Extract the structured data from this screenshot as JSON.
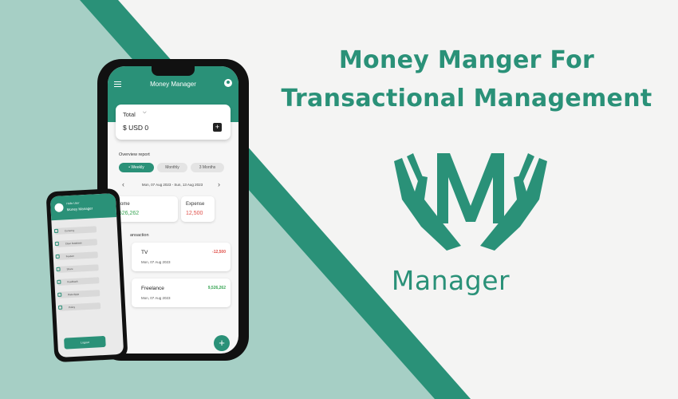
{
  "headline": [
    "Money Manger For",
    "Transactional Management"
  ],
  "logo_word": "Manager",
  "colors": {
    "accent": "#2a9178",
    "accent_light": "#a6cfc5",
    "income": "#3aa655",
    "expense": "#e0504a"
  },
  "app": {
    "title": "Money Manager",
    "total_label": "Total",
    "total_value": "$ USD 0",
    "overview_label": "Overview report",
    "tabs": [
      "Weekly",
      "Monthly",
      "3 Months"
    ],
    "active_tab": "Weekly",
    "date_range": "Mon, 07 Aug 2023 - Sun, 13 Aug 2023",
    "income_label": "Income",
    "income_value": "9,526,262",
    "expense_label": "Expense",
    "expense_value": "12,500",
    "section_label": "ansaction",
    "transactions": [
      {
        "name": "TV",
        "date": "Mon, 07 Aug 2023",
        "amount": "-12,500",
        "type": "expense"
      },
      {
        "name": "Freelance",
        "date": "Mon, 07 Aug 2023",
        "amount": "9,526,262",
        "type": "income"
      }
    ]
  },
  "drawer": {
    "greeting": "Hello User",
    "name": "Money Manager",
    "items": [
      "Currency",
      "Clear Database",
      "Feature",
      "Share",
      "Feedback",
      "Rate Apps",
      "Policy"
    ],
    "logout": "Logout"
  }
}
